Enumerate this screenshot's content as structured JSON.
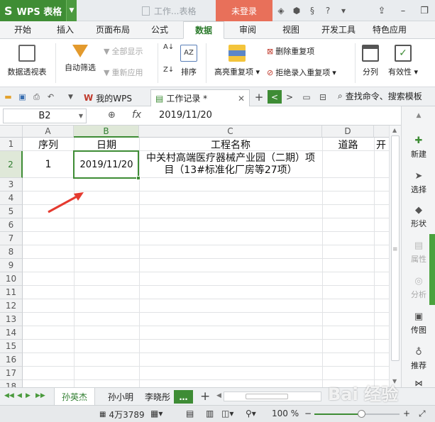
{
  "titlebar": {
    "app_name": "WPS 表格",
    "doc_title": "工作...表格",
    "login_label": "未登录"
  },
  "ribbon_tabs": [
    {
      "label": "开始"
    },
    {
      "label": "插入"
    },
    {
      "label": "页面布局"
    },
    {
      "label": "公式"
    },
    {
      "label": "数据",
      "active": true
    },
    {
      "label": "审阅"
    },
    {
      "label": "视图"
    },
    {
      "label": "开发工具"
    },
    {
      "label": "特色应用"
    }
  ],
  "ribbon": {
    "pivot_label": "数据透视表",
    "autofilter_label": "自动筛选",
    "show_all_label": "全部显示",
    "reapply_label": "重新应用",
    "sort_label": "排序",
    "highlight_dup_label": "高亮重复项",
    "delete_dup_label": "删除重复项",
    "reject_dup_label": "拒绝录入重复项",
    "split_label": "分列",
    "validity_label": "有效性"
  },
  "docbar": {
    "tabs": [
      {
        "label": "我的WPS"
      },
      {
        "label": "工作记录 *",
        "active": true
      }
    ],
    "search_label": "查找命令、搜索模板"
  },
  "formula_bar": {
    "cell_ref": "B2",
    "fx_label": "fx",
    "value": "2019/11/20"
  },
  "grid": {
    "columns": [
      "A",
      "B",
      "C",
      "D"
    ],
    "rows": [
      "1",
      "2",
      "3",
      "4",
      "5",
      "6",
      "7",
      "8",
      "9",
      "10",
      "11",
      "12",
      "13",
      "14",
      "15",
      "16",
      "17",
      "18"
    ],
    "header_row": {
      "a": "序列",
      "b": "日期",
      "c": "工程名称",
      "d": "道路",
      "e": "开"
    },
    "row2": {
      "a": "1",
      "b": "2019/11/20",
      "c": "中关村高端医疗器械产业园（二期）项目（13#标准化厂房等27项）"
    }
  },
  "sidebar": [
    {
      "label": "新建",
      "icon": "plus-icon"
    },
    {
      "label": "选择",
      "icon": "cursor-icon"
    },
    {
      "label": "形状",
      "icon": "shapes-icon"
    },
    {
      "label": "属性",
      "icon": "properties-icon",
      "disabled": true
    },
    {
      "label": "分析",
      "icon": "analysis-icon",
      "disabled": true
    },
    {
      "label": "传图",
      "icon": "image-upload-icon"
    },
    {
      "label": "推荐",
      "icon": "recommend-icon"
    }
  ],
  "sheets": [
    {
      "label": "孙英杰",
      "active": true
    },
    {
      "label": "孙小明"
    },
    {
      "label": "李晓彤"
    }
  ],
  "sheet_more": "…",
  "status": {
    "count": "4万3789",
    "zoom": "100 %"
  },
  "zoom_level": 0.55,
  "watermark": "Bai 经验"
}
